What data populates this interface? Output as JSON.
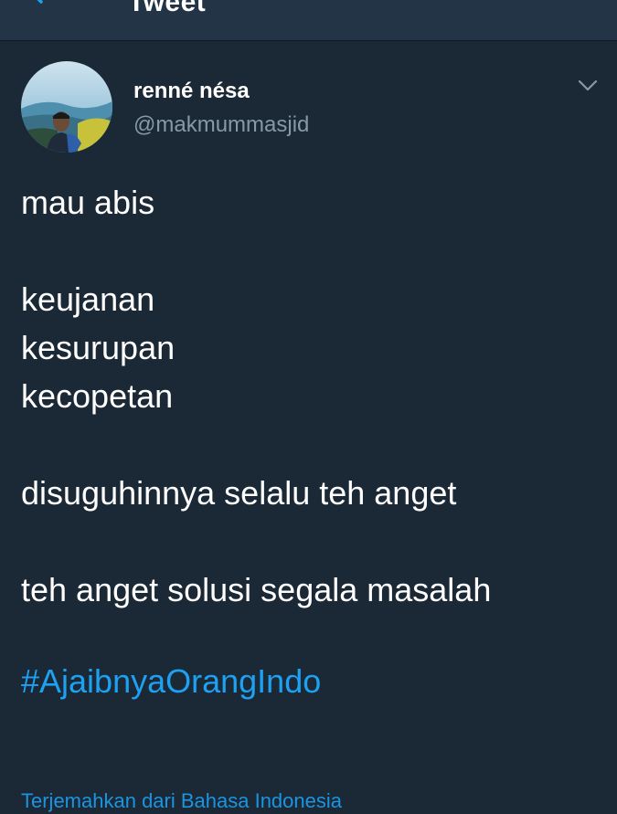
{
  "header": {
    "title": "Tweet",
    "back_icon": "back-arrow-icon"
  },
  "tweet": {
    "author": {
      "display_name": "renné nésa",
      "handle": "@makmummasjid"
    },
    "menu_icon": "chevron-down-icon",
    "lines": [
      "mau abis",
      "",
      "keujanan",
      "kesurupan",
      "kecopetan",
      "",
      "disuguhinnya selalu teh anget",
      "",
      "teh anget solusi segala masalah"
    ],
    "hashtag": "#AjaibnyaOrangIndo",
    "translate_link": "Terjemahkan dari Bahasa Indonesia"
  },
  "colors": {
    "background": "#1b2836",
    "header_bg": "#233446",
    "handle": "#8899a6",
    "link": "#1da1f2"
  }
}
